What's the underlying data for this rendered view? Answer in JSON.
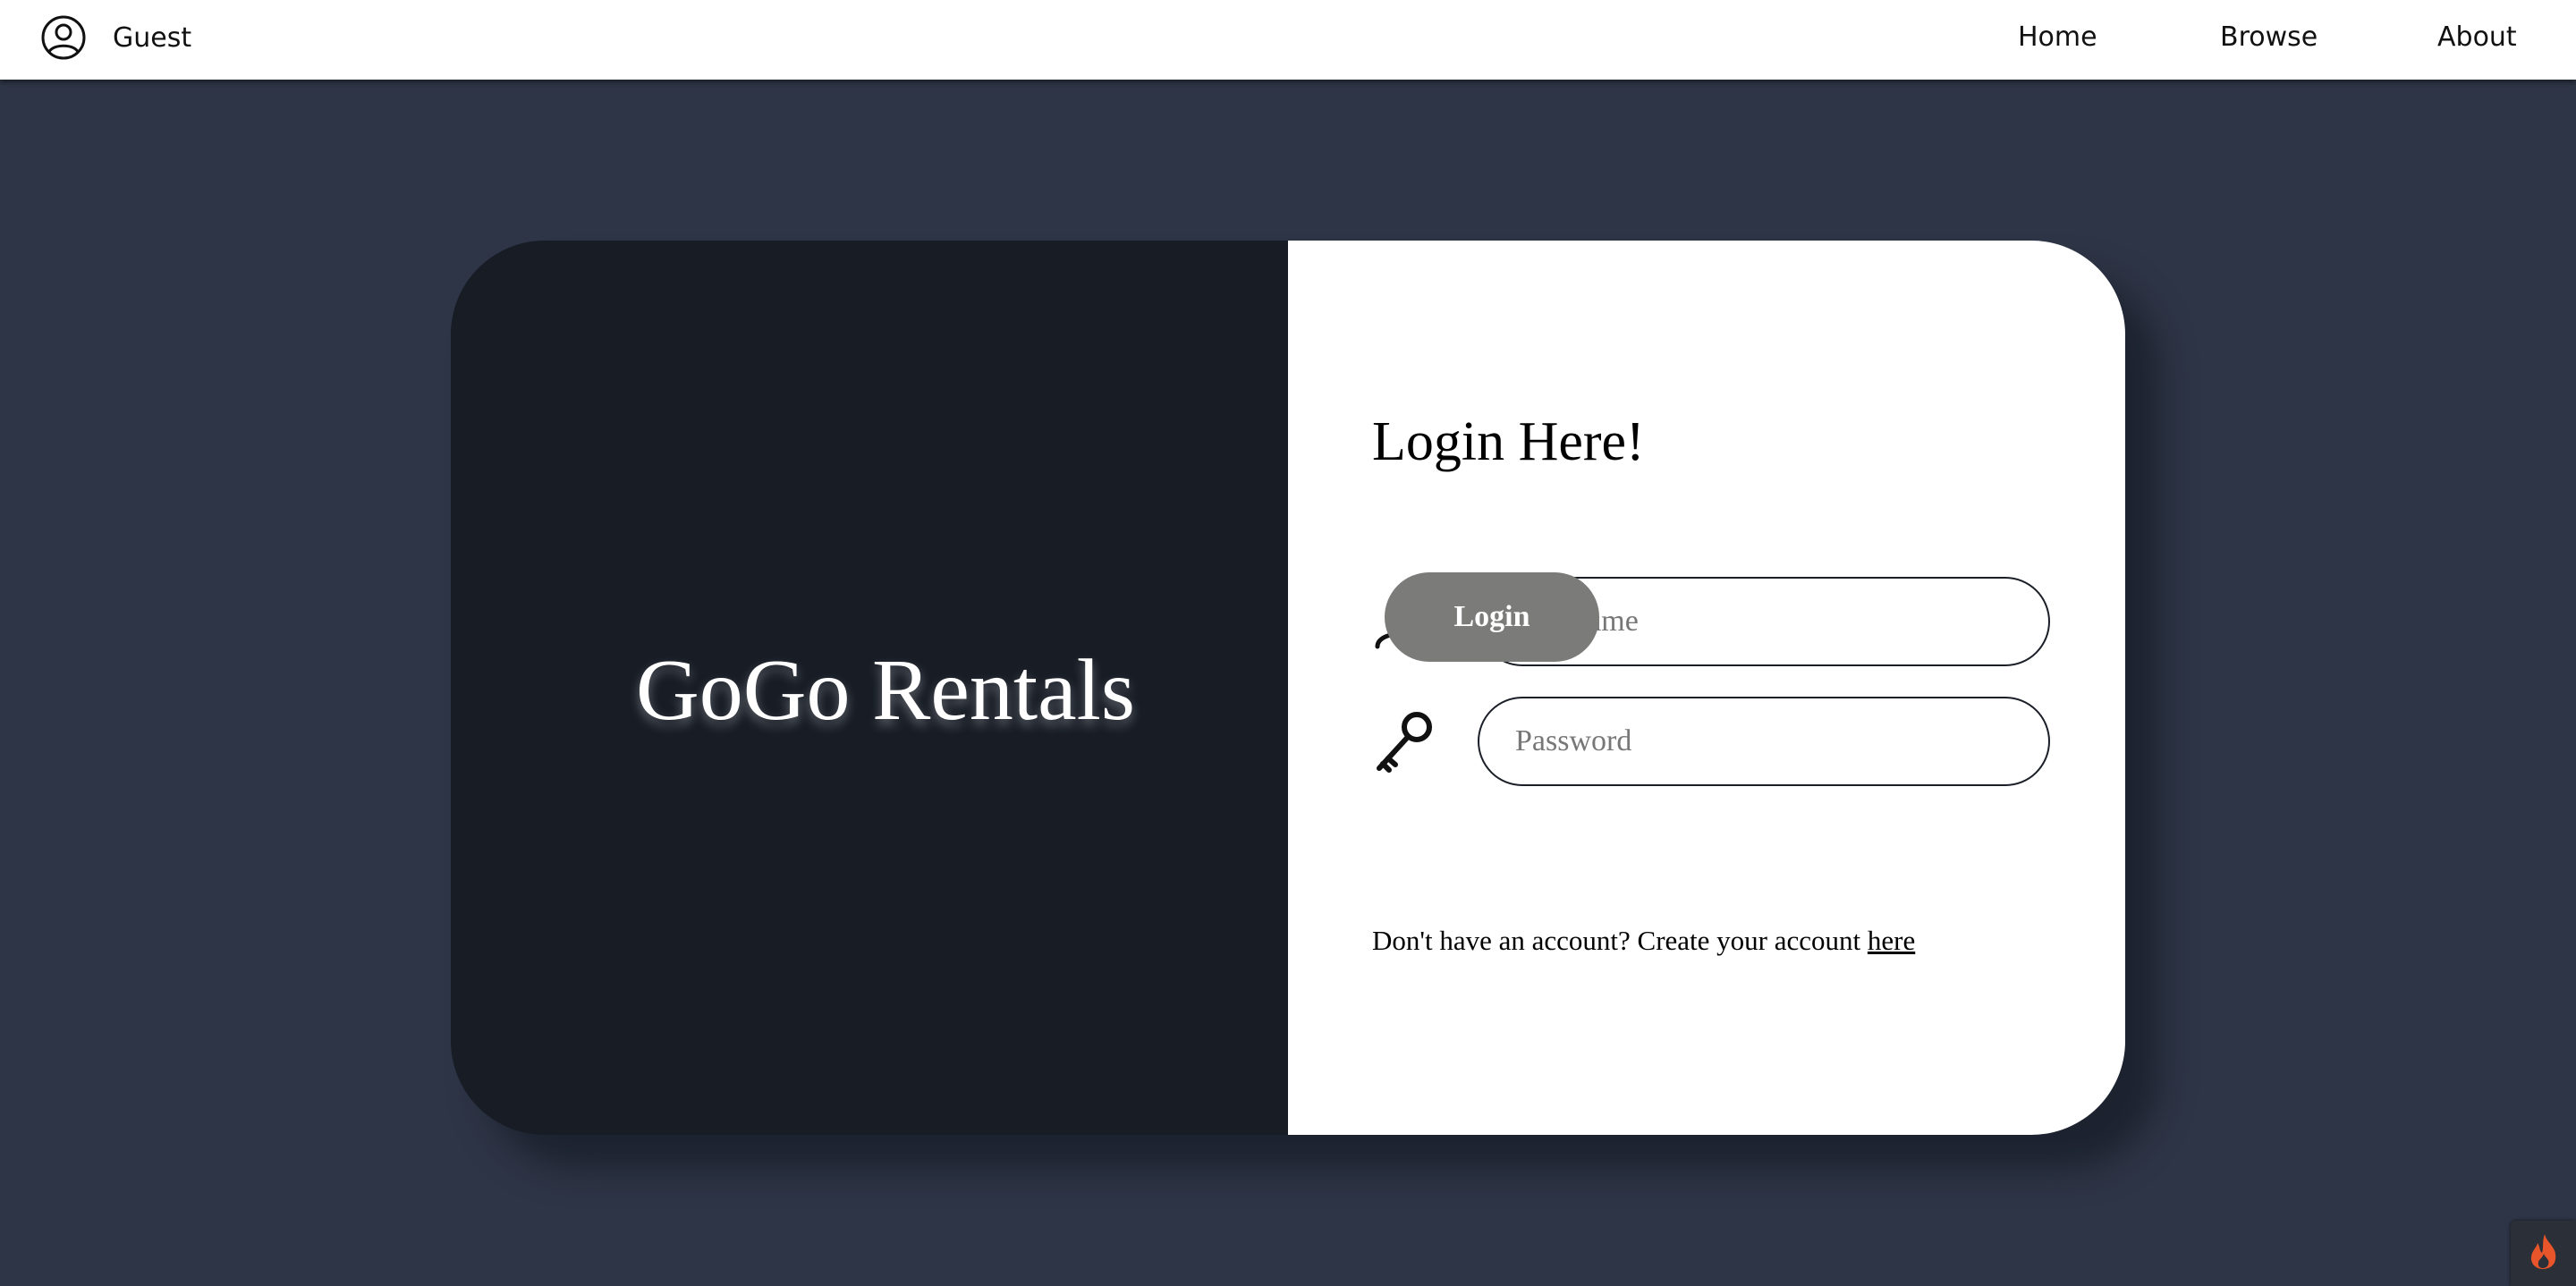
{
  "header": {
    "user_label": "Guest",
    "nav": {
      "home": "Home",
      "browse": "Browse",
      "about": "About"
    }
  },
  "brand": {
    "name": "GoGo Rentals"
  },
  "login": {
    "title": "Login Here!",
    "username_placeholder": "Username",
    "password_placeholder": "Password",
    "button_label": "Login",
    "signup_prompt": "Don't have an account? Create your account",
    "signup_link": "here"
  },
  "icons": {
    "account": "user-circle-icon",
    "username": "user-icon",
    "password": "key-icon",
    "widget": "flame-icon"
  },
  "colors": {
    "page_bg": "#2e3546",
    "card_dark": "#171c25",
    "button_gray": "#7b7b7a",
    "flame": "#e8552a"
  }
}
